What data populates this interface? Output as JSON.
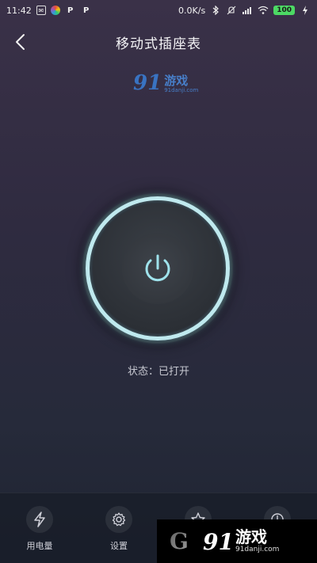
{
  "status_bar": {
    "time": "11:42",
    "speed": "0.0K/s",
    "battery": "100",
    "icons": [
      "mail-icon",
      "colorwheel-icon",
      "p-icon",
      "p-icon",
      "bluetooth-icon",
      "mute-icon",
      "signal-icon",
      "wifi-icon",
      "charging-icon"
    ]
  },
  "header": {
    "title": "移动式插座表"
  },
  "watermark_top": {
    "logo": "91",
    "name": "游戏",
    "url": "91danji.com"
  },
  "power": {
    "ring_color": "#bfe9ee"
  },
  "status": {
    "text": "状态：已打开"
  },
  "nav": {
    "items": [
      {
        "label": "用电量",
        "icon": "lightning-icon"
      },
      {
        "label": "设置",
        "icon": "gear-icon"
      },
      {
        "label": "",
        "icon": "star-icon"
      },
      {
        "label": "",
        "icon": "timer-icon"
      }
    ]
  },
  "watermark_bottom": {
    "logo": "91",
    "name": "游戏",
    "url": "91danji.com",
    "g_mark": "G"
  }
}
